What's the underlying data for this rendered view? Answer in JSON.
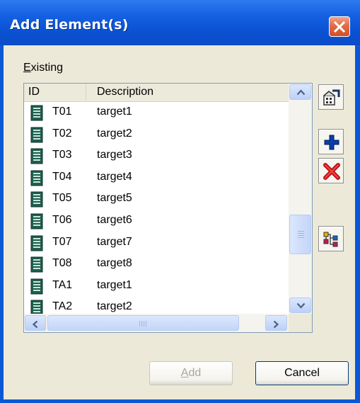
{
  "window": {
    "title": "Add Element(s)",
    "close_icon": "close-icon"
  },
  "existing_label": {
    "mnemonic": "E",
    "rest": "xisting"
  },
  "list": {
    "columns": [
      "ID",
      "Description"
    ],
    "rows": [
      {
        "id": "T01",
        "description": "target1",
        "icon": "document-icon"
      },
      {
        "id": "T02",
        "description": "target2",
        "icon": "document-icon"
      },
      {
        "id": "T03",
        "description": "target3",
        "icon": "document-icon"
      },
      {
        "id": "T04",
        "description": "target4",
        "icon": "document-icon"
      },
      {
        "id": "T05",
        "description": "target5",
        "icon": "document-icon"
      },
      {
        "id": "T06",
        "description": "target6",
        "icon": "document-icon"
      },
      {
        "id": "T07",
        "description": "target7",
        "icon": "document-icon"
      },
      {
        "id": "T08",
        "description": "target8",
        "icon": "document-icon"
      },
      {
        "id": "TA1",
        "description": "target1",
        "icon": "document-icon"
      },
      {
        "id": "TA2",
        "description": "target2",
        "icon": "document-icon"
      }
    ]
  },
  "toolbar": {
    "buttons": [
      {
        "name": "properties-button",
        "icon": "properties-icon"
      },
      {
        "name": "add-new-button",
        "icon": "plus-icon"
      },
      {
        "name": "delete-button",
        "icon": "delete-x-icon"
      },
      {
        "name": "hierarchy-button",
        "icon": "hierarchy-icon"
      }
    ]
  },
  "buttons": {
    "add_mnemonic": "A",
    "add_rest": "dd",
    "add_enabled": false,
    "cancel_label": "Cancel"
  },
  "colors": {
    "title_bar": "#0a52d3",
    "dialog_face": "#ece9d8",
    "plus_blue": "#0a3ea8",
    "delete_red": "#c0121e"
  }
}
